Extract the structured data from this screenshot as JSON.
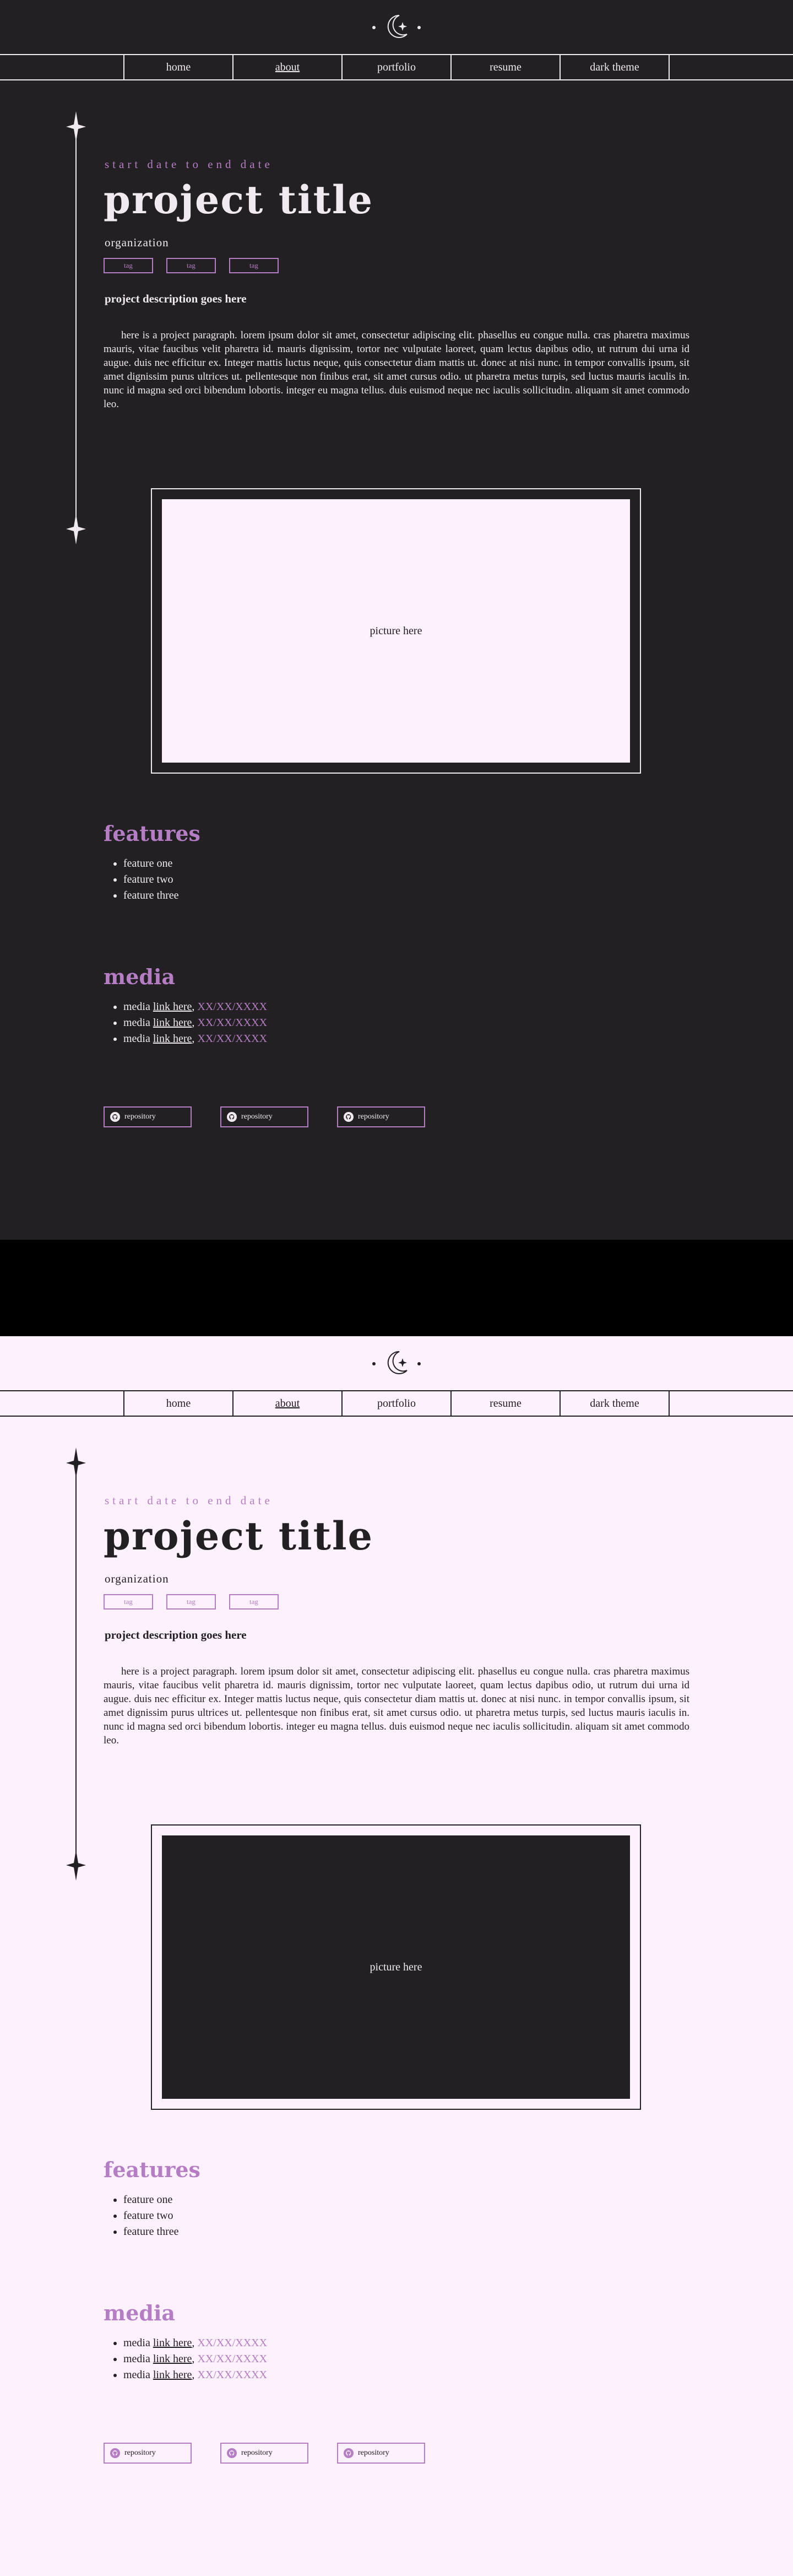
{
  "nav": {
    "items": [
      {
        "label": "home",
        "active": false
      },
      {
        "label": "about",
        "active": true
      },
      {
        "label": "portfolio",
        "active": false
      },
      {
        "label": "resume",
        "active": false
      },
      {
        "label": "dark theme",
        "active": false
      }
    ]
  },
  "project": {
    "date": "start date to end date",
    "title": "project title",
    "organization": "organization",
    "tags": [
      "tag",
      "tag",
      "tag"
    ],
    "description_title": "project description goes here",
    "paragraph": "here is a project paragraph. lorem ipsum dolor sit amet, consectetur adipiscing elit. phasellus eu congue nulla. cras pharetra maximus mauris, vitae faucibus velit pharetra id. mauris dignissim, tortor nec vulputate laoreet, quam lectus dapibus odio, ut rutrum dui urna id augue. duis nec efficitur ex. Integer mattis luctus neque, quis consectetur diam mattis ut. donec at nisi nunc. in tempor convallis ipsum, sit amet dignissim purus ultrices ut. pellentesque non finibus erat, sit amet cursus odio. ut pharetra metus turpis, sed luctus mauris iaculis in. nunc id magna sed orci bibendum lobortis. integer eu magna tellus. duis euismod neque nec iaculis sollicitudin. aliquam sit amet commodo leo.",
    "picture_label": "picture here"
  },
  "features": {
    "title": "features",
    "items": [
      "feature one",
      "feature two",
      "feature three"
    ]
  },
  "media": {
    "title": "media",
    "items": [
      {
        "prefix": "media ",
        "link": "link here",
        "sep": ", ",
        "date": "XX/XX/XXXX"
      },
      {
        "prefix": "media ",
        "link": "link here",
        "sep": ", ",
        "date": "XX/XX/XXXX"
      },
      {
        "prefix": "media ",
        "link": "link here",
        "sep": ", ",
        "date": "XX/XX/XXXX"
      }
    ]
  },
  "repos": [
    "repository",
    "repository",
    "repository"
  ],
  "colors": {
    "dark_bg": "#232024",
    "light_bg": "#fcf1fc",
    "accent": "#b57ec4",
    "gap": "#000000"
  },
  "icons": {
    "logo": "moon-stars-icon",
    "divider": "sparkle-line-icon",
    "repo": "github-icon"
  }
}
